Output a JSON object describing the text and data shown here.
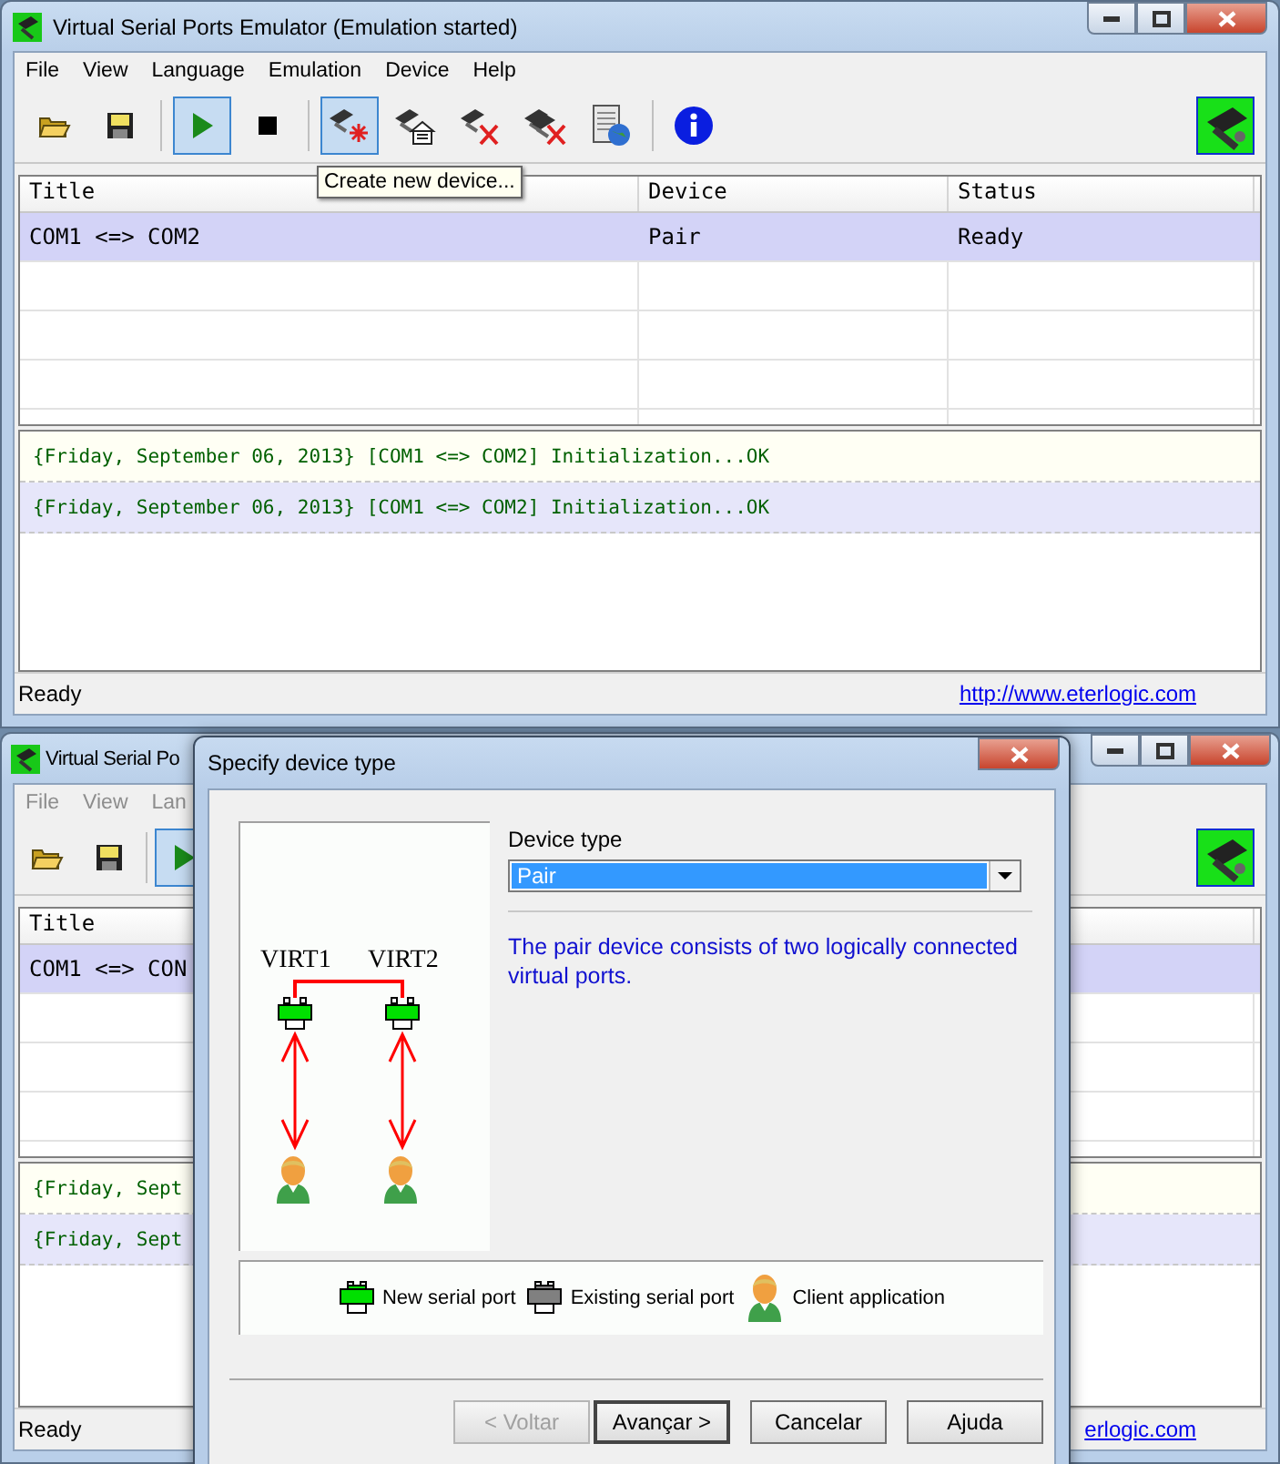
{
  "main_window": {
    "title": "Virtual Serial Ports Emulator (Emulation started)",
    "menu": [
      {
        "label": "File",
        "disabled": false
      },
      {
        "label": "View",
        "disabled": false
      },
      {
        "label": "Language",
        "disabled": false
      },
      {
        "label": "Emulation",
        "disabled": false
      },
      {
        "label": "Device",
        "disabled": false
      },
      {
        "label": "Help",
        "disabled": false
      }
    ],
    "toolbar": [
      {
        "kind": "open",
        "pressed": false
      },
      {
        "kind": "save",
        "pressed": false
      },
      {
        "kind": "sep"
      },
      {
        "kind": "play",
        "pressed": true
      },
      {
        "kind": "stop",
        "pressed": false
      },
      {
        "kind": "sep"
      },
      {
        "kind": "new-device",
        "pressed": true
      },
      {
        "kind": "device-props",
        "pressed": false
      },
      {
        "kind": "delete-device",
        "pressed": false
      },
      {
        "kind": "delete-all",
        "pressed": false
      },
      {
        "kind": "monitor",
        "pressed": false
      },
      {
        "kind": "sep"
      },
      {
        "kind": "info",
        "pressed": false
      }
    ],
    "tooltip": "Create new device...",
    "table": {
      "columns": [
        "Title",
        "Device",
        "Status"
      ],
      "rows": [
        {
          "cells": [
            "COM1 <=> COM2",
            "Pair",
            "Ready"
          ],
          "selected": true
        }
      ]
    },
    "log": [
      {
        "text": "{Friday, September 06, 2013} [COM1 <=> COM2] Initialization...OK",
        "selected": false
      },
      {
        "text": "{Friday, September 06, 2013} [COM1 <=> COM2] Initialization...OK",
        "selected": true
      }
    ],
    "status_bar": {
      "text": "Ready",
      "link": "http://www.eterlogic.com"
    }
  },
  "background_window": {
    "title": "Virtual Serial Po",
    "menu": [
      {
        "label": "File",
        "disabled": true
      },
      {
        "label": "View",
        "disabled": true
      },
      {
        "label": "Lan",
        "disabled": true
      }
    ],
    "toolbar": [
      {
        "kind": "open",
        "pressed": false
      },
      {
        "kind": "save",
        "pressed": false
      },
      {
        "kind": "sep"
      },
      {
        "kind": "play",
        "pressed": true
      }
    ],
    "table": {
      "columns": [
        "Title"
      ],
      "rows": [
        {
          "cells": [
            "COM1 <=> CON"
          ],
          "selected": true
        }
      ]
    },
    "log": [
      {
        "text": "{Friday, Sept",
        "selected": false
      },
      {
        "text": "{Friday, Sept",
        "selected": true
      }
    ],
    "status_bar": {
      "text": "Ready",
      "link": "erlogic.com"
    }
  },
  "dialog": {
    "title": "Specify device type",
    "device_type": {
      "label": "Device type",
      "value": "Pair"
    },
    "description": "The pair device consists of two logically connected virtual ports.",
    "diagram_labels": [
      "VIRT1",
      "VIRT2"
    ],
    "legend": [
      {
        "kind": "new-port",
        "label": "New serial port"
      },
      {
        "kind": "existing-port",
        "label": "Existing serial port"
      },
      {
        "kind": "client",
        "label": "Client application"
      }
    ],
    "buttons": [
      {
        "label": "< Voltar",
        "disabled": true,
        "default": false
      },
      {
        "label": "Avançar >",
        "disabled": false,
        "default": true
      },
      {
        "label": "Cancelar",
        "disabled": false,
        "default": false
      },
      {
        "label": "Ajuda",
        "disabled": false,
        "default": false
      }
    ]
  }
}
